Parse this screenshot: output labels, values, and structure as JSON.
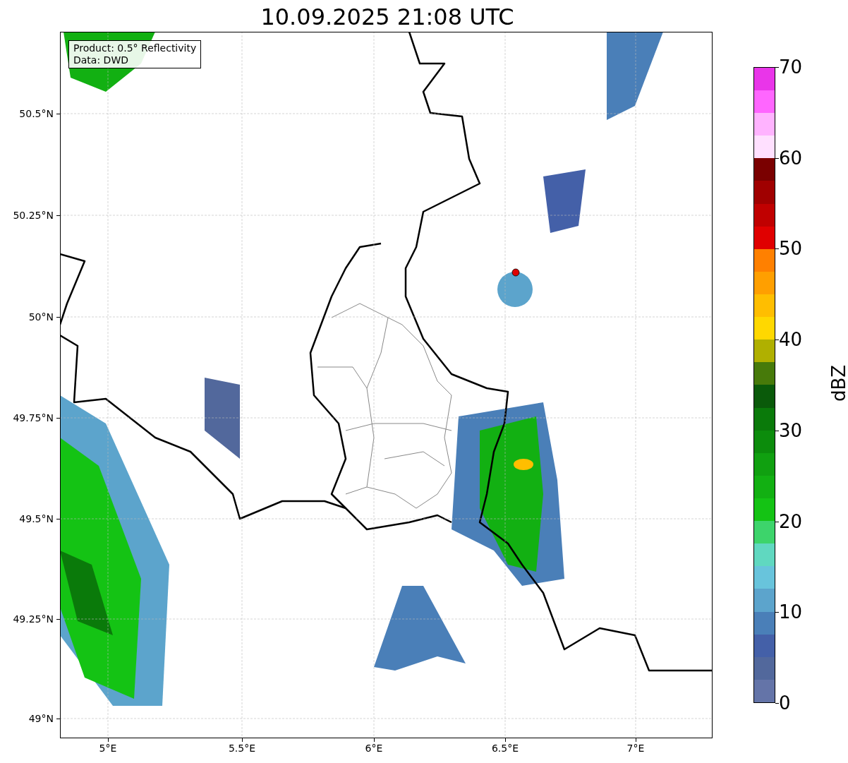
{
  "title": "10.09.2025 21:08 UTC",
  "info_box": [
    "Product: 0.5° Reflectivity",
    "Data: DWD"
  ],
  "map": {
    "y_ticks": [
      "50.5°N",
      "50.25°N",
      "50°N",
      "49.75°N",
      "49.5°N",
      "49.25°N",
      "49°N"
    ],
    "x_ticks": [
      "5°E",
      "5.5°E",
      "6°E",
      "6.5°E",
      "7°E"
    ]
  },
  "colorbar": {
    "label": "dBZ",
    "ticks": [
      "70",
      "60",
      "50",
      "40",
      "30",
      "20",
      "10",
      "0"
    ],
    "bands": [
      {
        "color": "#6474a8"
      },
      {
        "color": "#52689c"
      },
      {
        "color": "#4460a8"
      },
      {
        "color": "#4a7fb8"
      },
      {
        "color": "#5ca4cc"
      },
      {
        "color": "#68c4dc"
      },
      {
        "color": "#60d8c0"
      },
      {
        "color": "#3dd46b"
      },
      {
        "color": "#14c314"
      },
      {
        "color": "#12b012"
      },
      {
        "color": "#10a010"
      },
      {
        "color": "#0c8c0c"
      },
      {
        "color": "#0a7a0a"
      },
      {
        "color": "#0a5a0a"
      },
      {
        "color": "#477a0a"
      },
      {
        "color": "#b0b000"
      },
      {
        "color": "#ffd800"
      },
      {
        "color": "#ffbe00"
      },
      {
        "color": "#ff9f00"
      },
      {
        "color": "#ff8000"
      },
      {
        "color": "#e00000"
      },
      {
        "color": "#c00000"
      },
      {
        "color": "#a00000"
      },
      {
        "color": "#7a0000"
      },
      {
        "color": "#ffe0ff"
      },
      {
        "color": "#ffb3ff"
      },
      {
        "color": "#ff66ff"
      },
      {
        "color": "#e935e9"
      }
    ]
  }
}
